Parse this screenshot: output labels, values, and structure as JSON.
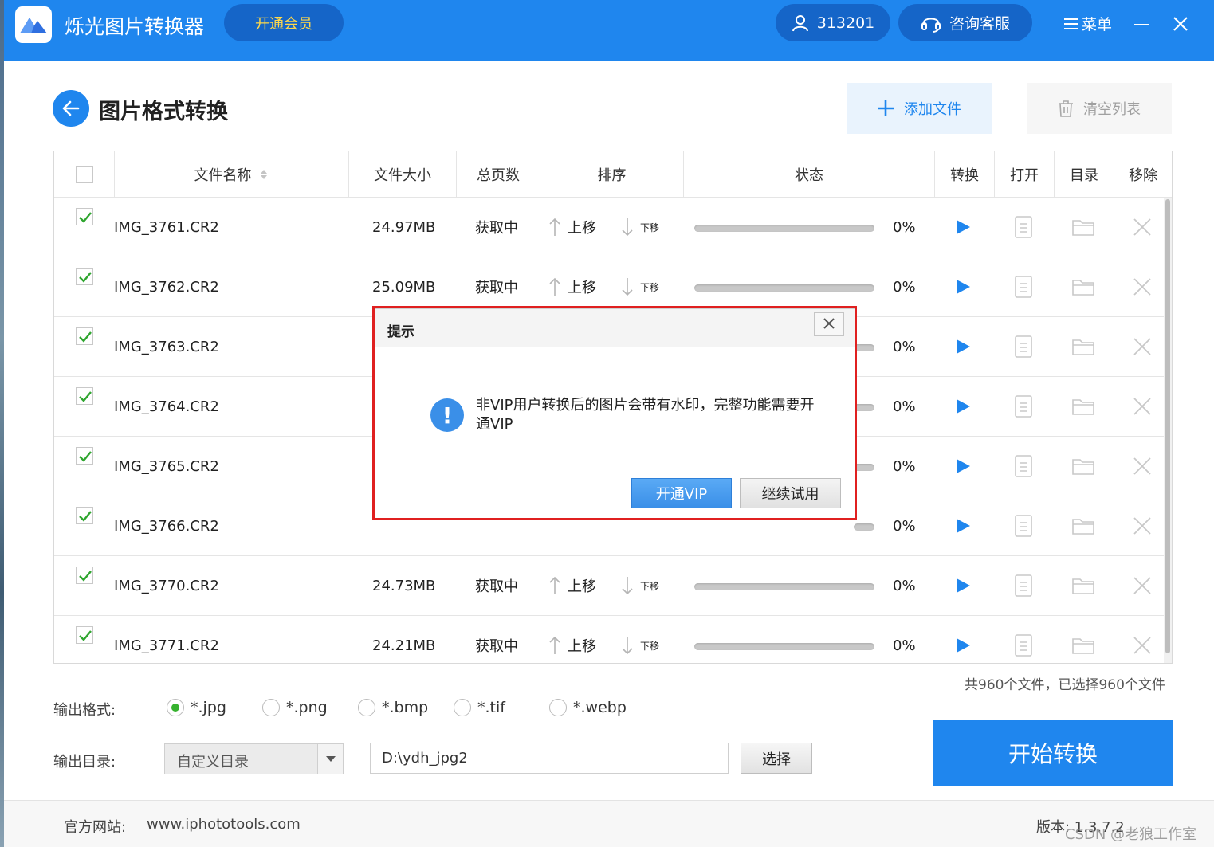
{
  "titlebar": {
    "app_title": "烁光图片转换器",
    "vip_label": "开通会员",
    "user_id": "313201",
    "support_label": "咨询客服",
    "menu_label": "菜单",
    "brand_color": "#1f86ee"
  },
  "page": {
    "title": "图片格式转换",
    "add_label": "添加文件",
    "clear_label": "清空列表"
  },
  "table": {
    "columns": [
      "文件名称",
      "文件大小",
      "总页数",
      "排序",
      "状态",
      "转换",
      "打开",
      "目录",
      "移除"
    ],
    "move_up": "上移",
    "move_down": "下移",
    "rows": [
      {
        "name": "IMG_3761.CR2",
        "size": "24.97MB",
        "pages": "获取中",
        "progress": "0%"
      },
      {
        "name": "IMG_3762.CR2",
        "size": "25.09MB",
        "pages": "获取中",
        "progress": "0%"
      },
      {
        "name": "IMG_3763.CR2",
        "size": "",
        "pages": "",
        "progress": "0%"
      },
      {
        "name": "IMG_3764.CR2",
        "size": "",
        "pages": "",
        "progress": "0%"
      },
      {
        "name": "IMG_3765.CR2",
        "size": "",
        "pages": "",
        "progress": "0%"
      },
      {
        "name": "IMG_3766.CR2",
        "size": "",
        "pages": "",
        "progress": "0%"
      },
      {
        "name": "IMG_3770.CR2",
        "size": "24.73MB",
        "pages": "获取中",
        "progress": "0%"
      },
      {
        "name": "IMG_3771.CR2",
        "size": "24.21MB",
        "pages": "获取中",
        "progress": "0%"
      }
    ]
  },
  "count_text": "共960个文件，已选择960个文件",
  "output": {
    "format_label": "输出格式:",
    "formats": [
      "*.jpg",
      "*.png",
      "*.bmp",
      "*.tif",
      "*.webp"
    ],
    "selected_format": "*.jpg",
    "dir_label": "输出目录:",
    "dir_mode": "自定义目录",
    "dir_path": "D:\\ydh_jpg2",
    "choose_label": "选择",
    "start_label": "开始转换"
  },
  "footer": {
    "site_label": "官方网站:",
    "site_url": "www.iphototools.com",
    "version": "版本: 1.3.7.2",
    "watermark": "CSDN @老狼工作室"
  },
  "dialog": {
    "title": "提示",
    "message": "非VIP用户转换后的图片会带有水印，完整功能需要开通VIP",
    "ok_label": "开通VIP",
    "cancel_label": "继续试用",
    "highlight_color": "#e02020"
  }
}
